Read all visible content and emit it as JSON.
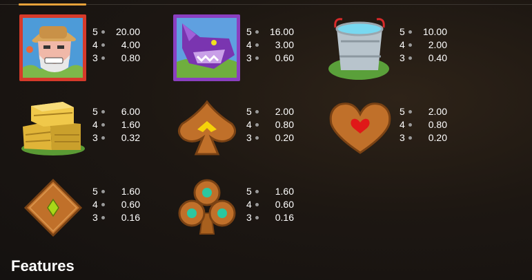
{
  "paytable": [
    {
      "symbol": "farmer-icon",
      "pays": [
        {
          "count": "5",
          "value": "20.00"
        },
        {
          "count": "4",
          "value": "4.00"
        },
        {
          "count": "3",
          "value": "0.80"
        }
      ]
    },
    {
      "symbol": "wolf-icon",
      "pays": [
        {
          "count": "5",
          "value": "16.00"
        },
        {
          "count": "4",
          "value": "3.00"
        },
        {
          "count": "3",
          "value": "0.60"
        }
      ]
    },
    {
      "symbol": "water-bucket-icon",
      "pays": [
        {
          "count": "5",
          "value": "10.00"
        },
        {
          "count": "4",
          "value": "2.00"
        },
        {
          "count": "3",
          "value": "0.40"
        }
      ]
    },
    {
      "symbol": "hay-bales-icon",
      "pays": [
        {
          "count": "5",
          "value": "6.00"
        },
        {
          "count": "4",
          "value": "1.60"
        },
        {
          "count": "3",
          "value": "0.32"
        }
      ]
    },
    {
      "symbol": "spade-icon",
      "pays": [
        {
          "count": "5",
          "value": "2.00"
        },
        {
          "count": "4",
          "value": "0.80"
        },
        {
          "count": "3",
          "value": "0.20"
        }
      ]
    },
    {
      "symbol": "heart-icon",
      "pays": [
        {
          "count": "5",
          "value": "2.00"
        },
        {
          "count": "4",
          "value": "0.80"
        },
        {
          "count": "3",
          "value": "0.20"
        }
      ]
    },
    {
      "symbol": "diamond-icon",
      "pays": [
        {
          "count": "5",
          "value": "1.60"
        },
        {
          "count": "4",
          "value": "0.60"
        },
        {
          "count": "3",
          "value": "0.16"
        }
      ]
    },
    {
      "symbol": "club-icon",
      "pays": [
        {
          "count": "5",
          "value": "1.60"
        },
        {
          "count": "4",
          "value": "0.60"
        },
        {
          "count": "3",
          "value": "0.16"
        }
      ]
    }
  ],
  "features_heading": "Features",
  "colors": {
    "accent": "#e8a33a",
    "wood": "#b5651d",
    "gem_yellow": "#f5d20a",
    "gem_red": "#e01818",
    "gem_green": "#2bc7a0"
  }
}
